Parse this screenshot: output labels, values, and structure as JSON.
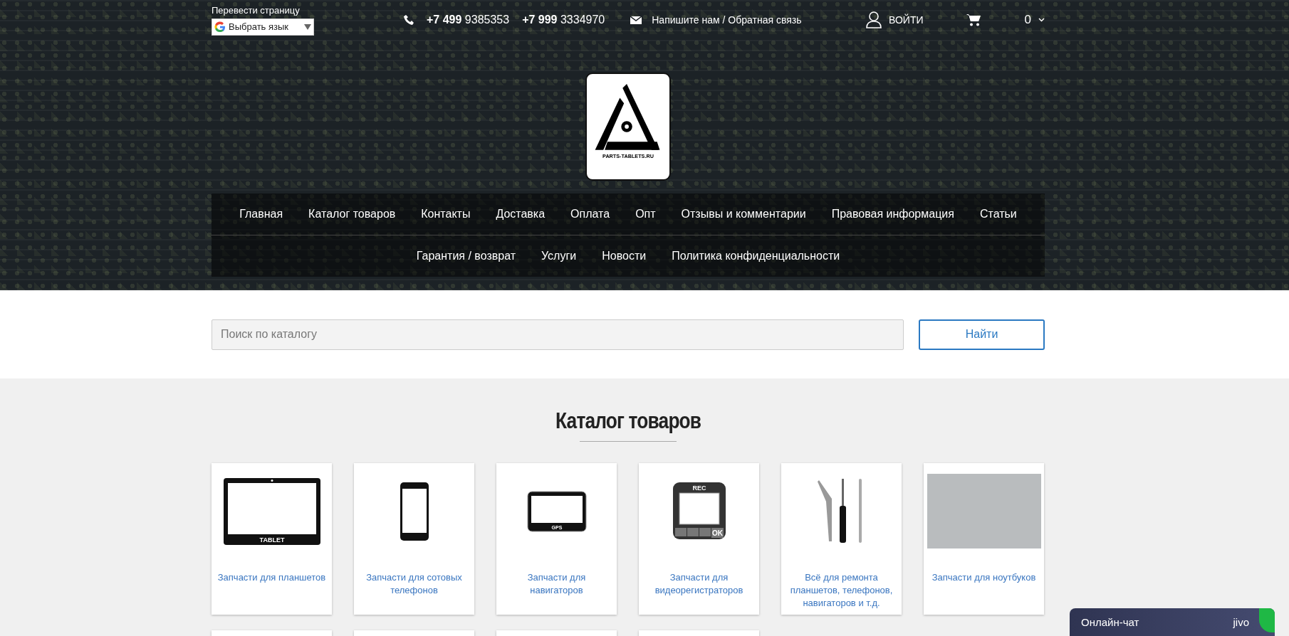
{
  "top_bar": {
    "translate_label": "Перевести страницу",
    "language_select": {
      "value": "Выбрать язык"
    },
    "phones": [
      "**+7 499** 9385353",
      "**+7 999** 3334970"
    ],
    "feedback_link": "Напишите нам / Обратная связь",
    "login": "ВОЙТИ",
    "cart_count": "0"
  },
  "logo": {
    "text": "PARTS-TABLETS.RU"
  },
  "nav": {
    "rows": [
      {
        "items": [
          "Главная",
          "Каталог товаров",
          "Контакты",
          "Доставка",
          "Оплата",
          "Опт",
          "Отзывы и комментарии",
          "Правовая информация",
          "Статьи"
        ]
      },
      {
        "items": [
          "Гарантия / возврат",
          "Услуги",
          "Новости",
          "Политика конфиденциальности"
        ]
      }
    ]
  },
  "search": {
    "placeholder": "Поиск по каталогу",
    "button": "Найти"
  },
  "catalog": {
    "title": "Каталог товаров",
    "cards": [
      {
        "kind": "tablet",
        "image_text": "TABLET",
        "label": "Запчасти для планшетов"
      },
      {
        "kind": "phone",
        "label": "Запчасти для сотовых телефонов"
      },
      {
        "kind": "gps",
        "image_text": "GPS",
        "label": "Запчасти для навигаторов"
      },
      {
        "kind": "dashcam",
        "image_text": "REC",
        "button_text": "OK",
        "label": "Запчасти для видеорегистраторов"
      },
      {
        "kind": "tools",
        "label": "Всё для ремонта планшетов, телефонов, навигаторов и т.д."
      },
      {
        "kind": "photo",
        "label": "Запчасти для ноутбуков"
      },
      {
        "kind": "cut"
      },
      {
        "kind": "cut"
      },
      {
        "kind": "cut"
      },
      {
        "kind": "cut"
      }
    ]
  },
  "chat": {
    "label": "Онлайн-чат",
    "brand": "jivo"
  }
}
